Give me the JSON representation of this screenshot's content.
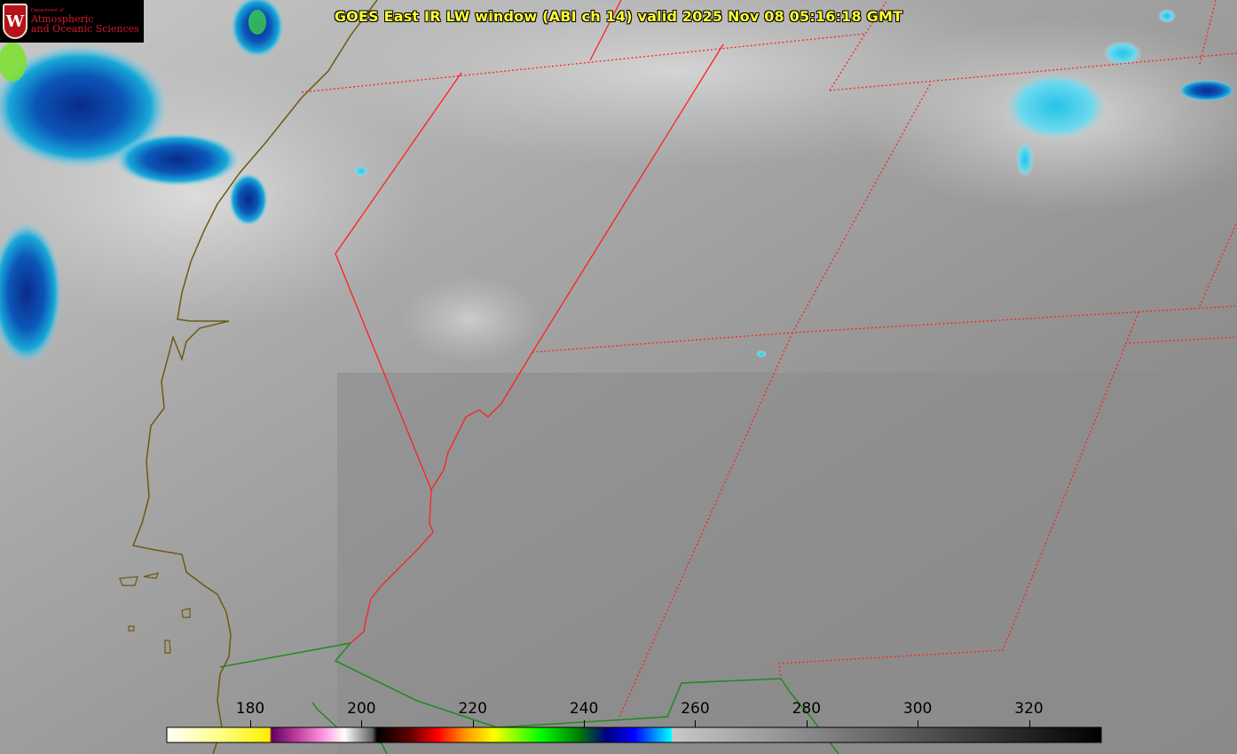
{
  "title": "GOES East IR LW window (ABI ch 14) valid 2025 Nov 08 05:16:18 GMT",
  "logo": {
    "department": "Department of",
    "line1": "Atmospheric",
    "line2": "and Oceanic Sciences",
    "crest_letter": "W"
  },
  "colorbar": {
    "ticks": [
      "180",
      "200",
      "220",
      "240",
      "260",
      "280",
      "300",
      "320"
    ],
    "min": 165,
    "max": 333
  },
  "colors": {
    "state_borders": "#ff2020",
    "coastline": "#6b5a10",
    "country_border": "#1f8a1f",
    "title_text": "#ffff33",
    "logo_text": "#d11a2a"
  }
}
